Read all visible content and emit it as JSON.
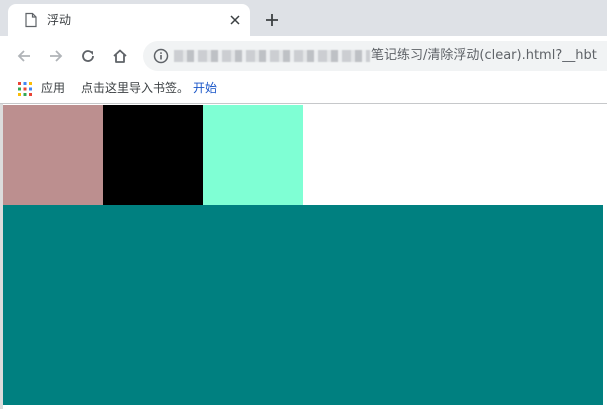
{
  "tab": {
    "title": "浮动",
    "icon": "page-icon",
    "close_icon": "close-icon"
  },
  "new_tab_icon": "plus-icon",
  "toolbar": {
    "back_icon": "arrow-left-icon",
    "forward_icon": "arrow-right-icon",
    "reload_icon": "reload-icon",
    "home_icon": "home-icon"
  },
  "omnibox": {
    "info_icon": "info-icon",
    "url_visible": "笔记练习/清除浮动(clear).html?__hbt"
  },
  "bookmarks": {
    "apps_icon": "apps-grid-icon",
    "apps_label": "应用",
    "import_hint": "点击这里导入书签。",
    "start_link": "开始"
  },
  "page": {
    "boxes": [
      {
        "color": "#bc8f8f"
      },
      {
        "color": "#000000"
      },
      {
        "color": "#7fffd4"
      }
    ],
    "block_color": "#008080"
  }
}
